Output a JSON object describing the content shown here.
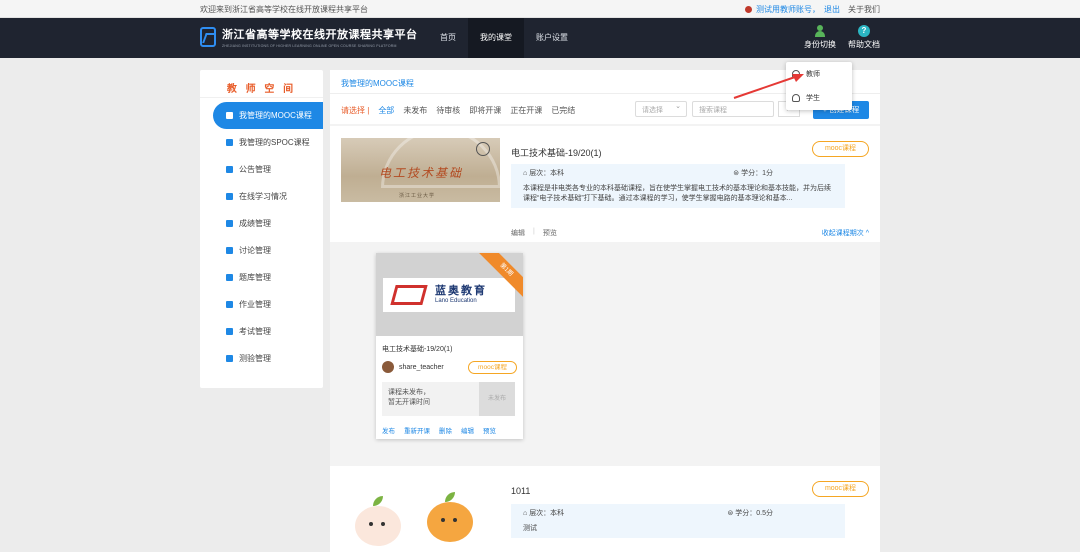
{
  "topstrip": {
    "welcome": "欢迎来到浙江省高等学校在线开放课程共享平台",
    "account": "测试用教师账号，",
    "logout": "退出",
    "about": "关于我们"
  },
  "navbar": {
    "logo_title": "浙江省高等学校在线开放课程共享平台",
    "logo_subtitle": "ZHEJIANG INSTITUTIONS OF HIGHER LEARNING ONLINE OPEN COURSE SHARING PLATFORM",
    "nav": [
      "首页",
      "我的课堂",
      "账户设置"
    ],
    "switch_identity": "身份切换",
    "help_docs": "帮助文档"
  },
  "sidebar": {
    "title": "教 师 空 间",
    "items": [
      "我管理的MOOC课程",
      "我管理的SPOC课程",
      "公告管理",
      "在线学习情况",
      "成绩管理",
      "讨论管理",
      "题库管理",
      "作业管理",
      "考试管理",
      "测验管理"
    ]
  },
  "main": {
    "breadcrumb": "我管理的MOOC课程",
    "filter_label": "请选择 |",
    "filters": [
      "全部",
      "未发布",
      "待审核",
      "即将开课",
      "正在开课",
      "已完结"
    ],
    "select_placeholder": "请选择",
    "search_placeholder": "搜索课程",
    "create_button": "+ 创建课程"
  },
  "course1": {
    "name": "电工技术基础-19/20(1)",
    "tag": "mooc课程",
    "level": "层次：本科",
    "credit": "学分：1分",
    "desc": "本课程是非电类各专业的本科基础课程，旨在使学生掌握电工技术的基本理论和基本技能，并为后续课程“电子技术基础”打下基础。通过本课程的学习，使学生掌握电路的基本理论和基本...",
    "thumb_title": "电工技术基础",
    "thumb_uni": "浙江工业大学",
    "edit": "编辑",
    "preview": "预览",
    "collapse": "收起课程期次 ^"
  },
  "card": {
    "ribbon": "第1期",
    "brand_cn": "蓝奥教育",
    "brand_en": "Lano Education",
    "title": "电工技术基础-19/20(1)",
    "teacher": "share_teacher",
    "tag": "mooc课程",
    "status_line1": "课程未发布，",
    "status_line2": "暂无开课时间",
    "unpublished": "未发布",
    "actions": [
      "发布",
      "重新开课",
      "删除",
      "编辑",
      "预览"
    ]
  },
  "course2": {
    "name": "1011",
    "tag": "mooc课程",
    "level": "层次：本科",
    "credit": "学分：0.5分",
    "desc": "测试"
  },
  "dropdown": {
    "options": [
      "教师",
      "学生"
    ]
  }
}
